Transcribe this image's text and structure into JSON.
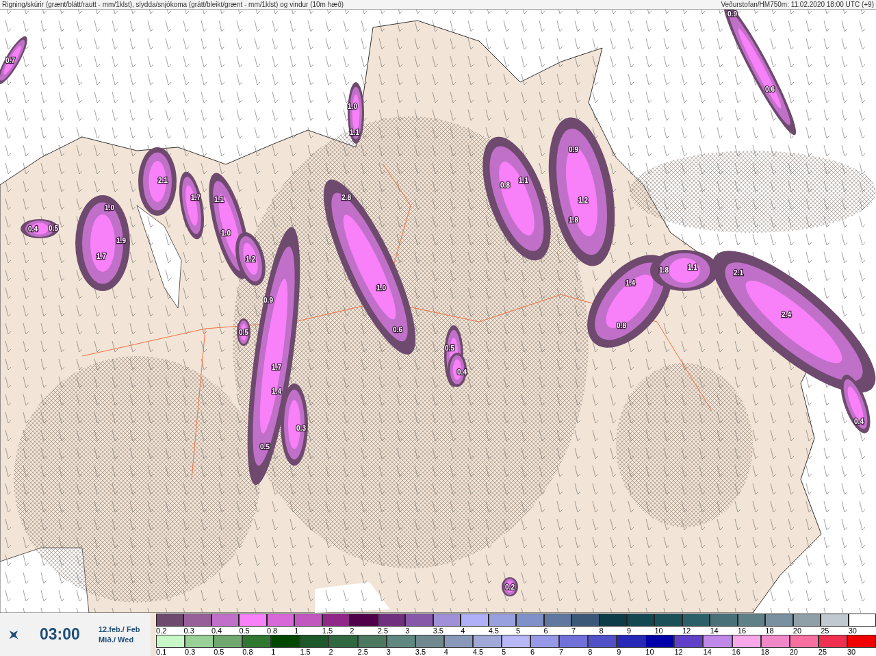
{
  "header": {
    "title": "Rigning/skúrir (grænt/blátt/rautt - mm/1klst), slydda/snjókoma (grátt/bleikt/grænt - mm/1klst) og vindur (10m hæð)",
    "source": "Veðurstofan/HM750m: 11.02.2020 18:00 UTC (+9)"
  },
  "map": {
    "labels": [
      "0.7",
      "0.9",
      "0.6",
      "1.0",
      "1.1",
      "0.9",
      "2.1",
      "0.8",
      "1.1",
      "1.7",
      "1.1",
      "2.8",
      "1.0",
      "0.4",
      "0.5",
      "1.2",
      "1.8",
      "1.0",
      "1.9",
      "1.7",
      "1.2",
      "1.8",
      "1.1",
      "2.1",
      "1.4",
      "1.0",
      "0.9",
      "2.4",
      "0.8",
      "0.6",
      "0.5",
      "0.5",
      "0.4",
      "1.7",
      "1.4",
      "0.3",
      "0.4",
      "0.5",
      "0.2"
    ]
  },
  "time_panel": {
    "time": "03:00",
    "date": "12.feb./ Feb",
    "weekday": "Mið./ Wed"
  },
  "legend": [
    {
      "kind": "snow",
      "items": [
        {
          "label": "0.2",
          "color": "#6e4a6e"
        },
        {
          "label": "0.3",
          "color": "#98609a"
        },
        {
          "label": "0.4",
          "color": "#c070c8"
        },
        {
          "label": "0.5",
          "color": "#f880f8"
        },
        {
          "label": "0.8",
          "color": "#d868d8"
        },
        {
          "label": "1",
          "color": "#c058c0"
        },
        {
          "label": "1.5",
          "color": "#902888"
        },
        {
          "label": "2",
          "color": "#500048"
        },
        {
          "label": "2.5",
          "color": "#703080"
        },
        {
          "label": "3",
          "color": "#8858a8"
        },
        {
          "label": "3.5",
          "color": "#a090d8"
        },
        {
          "label": "4",
          "color": "#b0b0f8"
        },
        {
          "label": "4.5",
          "color": "#98a0e0"
        },
        {
          "label": "5",
          "color": "#8090c8"
        },
        {
          "label": "6",
          "color": "#6078a0"
        },
        {
          "label": "7",
          "color": "#3c5878"
        },
        {
          "label": "8",
          "color": "#0c3c48"
        },
        {
          "label": "9",
          "color": "#144850"
        },
        {
          "label": "10",
          "color": "#1c5058"
        },
        {
          "label": "12",
          "color": "#2c6068"
        },
        {
          "label": "14",
          "color": "#487078"
        },
        {
          "label": "16",
          "color": "#608088"
        },
        {
          "label": "18",
          "color": "#7890a0"
        },
        {
          "label": "20",
          "color": "#90a0a8"
        },
        {
          "label": "25",
          "color": "#c0c8d0"
        },
        {
          "label": "30",
          "color": "#ffffff"
        }
      ]
    },
    {
      "kind": "rain",
      "items": [
        {
          "label": "0.1",
          "color": "#c8f8c8"
        },
        {
          "label": "0.3",
          "color": "#98d098"
        },
        {
          "label": "0.5",
          "color": "#70a870"
        },
        {
          "label": "0.8",
          "color": "#307830"
        },
        {
          "label": "1",
          "color": "#004800"
        },
        {
          "label": "1.5",
          "color": "#1c5828"
        },
        {
          "label": "2",
          "color": "#306840"
        },
        {
          "label": "2.5",
          "color": "#4c7860"
        },
        {
          "label": "3",
          "color": "#608880"
        },
        {
          "label": "3.5",
          "color": "#708890"
        },
        {
          "label": "4",
          "color": "#8898b8"
        },
        {
          "label": "4.5",
          "color": "#a0a8d8"
        },
        {
          "label": "5",
          "color": "#b8b8f8"
        },
        {
          "label": "6",
          "color": "#9898e8"
        },
        {
          "label": "7",
          "color": "#7070d8"
        },
        {
          "label": "8",
          "color": "#5050c8"
        },
        {
          "label": "9",
          "color": "#2828b8"
        },
        {
          "label": "10",
          "color": "#0000a8"
        },
        {
          "label": "12",
          "color": "#6040c8"
        },
        {
          "label": "14",
          "color": "#c088e8"
        },
        {
          "label": "16",
          "color": "#f8a8e8"
        },
        {
          "label": "18",
          "color": "#f088c8"
        },
        {
          "label": "20",
          "color": "#f870a0"
        },
        {
          "label": "25",
          "color": "#f03050"
        },
        {
          "label": "30",
          "color": "#f00000"
        }
      ]
    }
  ]
}
